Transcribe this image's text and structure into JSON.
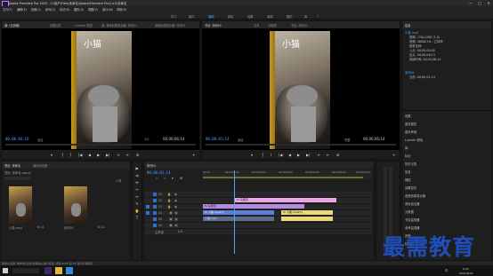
{
  "titlebar": {
    "title": "Adobe Premiere Pro 2020 - C:\\用户\\Files\\未命名\\Adobe\\Premiere Pro\\14.0\\未命名",
    "minimize": "—",
    "maximize": "□",
    "close": "✕"
  },
  "menubar": {
    "items": [
      "文件(F)",
      "编辑(E)",
      "剪辑(C)",
      "序列(S)",
      "标记(M)",
      "图形(G)",
      "视图(V)",
      "窗口(W)",
      "帮助(H)"
    ]
  },
  "workspace": {
    "items": [
      "学习",
      "组件",
      "编辑",
      "颜色",
      "效果",
      "音频",
      "图形",
      "库",
      "»"
    ],
    "active_index": 2
  },
  "source_monitor": {
    "tabs": [
      "源: (无剪辑)",
      "效果控件",
      "Lumetri 范围",
      "源: 音频剪辑混合器: 序列01",
      "音频剪辑混合器: 序列01"
    ],
    "caption": "小猫",
    "timecode_left": "00;00;04;16",
    "fit": "适合",
    "fraction": "1/2",
    "timecode_right": "00;00;06;14"
  },
  "program_monitor": {
    "tabs": [
      "节目: 序列01",
      "文本",
      "元数据",
      "节目: 序列01"
    ],
    "caption": "小猫",
    "timecode_left": "00;00;01;14",
    "fit": "适合",
    "fraction": "完整",
    "timecode_right": "00;00;06;14"
  },
  "transport": {
    "buttons": [
      "▾",
      "{",
      "}",
      "|◀",
      "◀",
      "▶",
      "▶|",
      "⇥",
      "⇤",
      "⊞",
      "+"
    ]
  },
  "project_panel": {
    "tabs": [
      "项目: 未命名",
      "媒体浏览器"
    ],
    "path": "项目: 未命名.prproj",
    "count": "1 项",
    "items": [
      {
        "name": "小猫.mp4",
        "duration": "6;14"
      },
      {
        "name": "序列01",
        "duration": "6;14"
      }
    ]
  },
  "timeline": {
    "tab": "序列01",
    "timecode": "00;00;01;14",
    "ruler": [
      "00;00",
      "00;00;01;00",
      "00;00;02;00",
      "00;00;03;00",
      "00;00;04;00",
      "00;00;05;00",
      "00;00;06;00"
    ],
    "tracks": [
      {
        "name": "V3"
      },
      {
        "name": "V2"
      },
      {
        "name": "V1"
      },
      {
        "name": "A1"
      },
      {
        "name": "A2"
      },
      {
        "name": "A3"
      }
    ],
    "master": "主声道",
    "master_value": "0.0",
    "clips": {
      "v3": "fx 马赛克",
      "v2": "fx 马赛克",
      "v1": "fx 小猫.mp4[V]",
      "v1b": "fx 小猫.mp4[V]",
      "a1": "小猫.mp4",
      "a1b": ""
    }
  },
  "right_panel": {
    "header": "信息",
    "info_lines": [
      "小猫.mp4",
      "视频: 720x1280 (1.0)",
      "音频: 48000 Hz - 立体声",
      "磁带名称:",
      "入点: 00;00;00;00",
      "出点: 00;00;06;13",
      "持续时间: 00;00;06;14",
      "序列01",
      "当前: 00;00;01;14"
    ],
    "items": [
      "效果",
      "基本图形",
      "基本声音",
      "Lumetri 颜色",
      "库",
      "标记",
      "历史记录",
      "信息",
      "捕捉",
      "效果控件",
      "音频剪辑混合器",
      "音轨混合器",
      "元数据",
      "节目监视器",
      "参考监视器",
      "进度",
      "标记"
    ]
  },
  "status": {
    "text": "单击以选择, 或单击空白处并拖动以进行框选. 按住 Shift 和 Alt 键可扩展选区."
  },
  "taskbar": {
    "time": "9:22",
    "date": "2021/6/24",
    "lang": "中"
  },
  "watermark": {
    "text": "最需教育"
  }
}
